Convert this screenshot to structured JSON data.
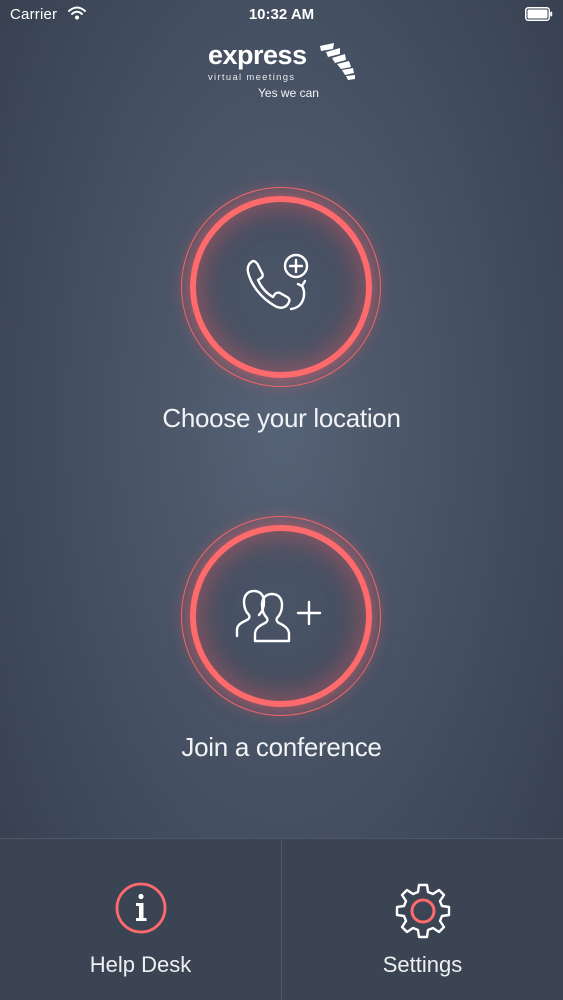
{
  "status_bar": {
    "carrier": "Carrier",
    "time": "10:32 AM"
  },
  "logo": {
    "brand": "express",
    "subtitle": "virtual meetings",
    "tagline": "Yes we can"
  },
  "actions": [
    {
      "label": "Choose your location",
      "icon": "phone-add-icon"
    },
    {
      "label": "Join a conference",
      "icon": "group-add-icon"
    }
  ],
  "tabs": [
    {
      "label": "Help Desk",
      "icon": "info-icon"
    },
    {
      "label": "Settings",
      "icon": "gear-icon"
    }
  ],
  "colors": {
    "accent": "#ff6a6c",
    "background": "#465163",
    "bottom_bar": "#3b4453"
  }
}
